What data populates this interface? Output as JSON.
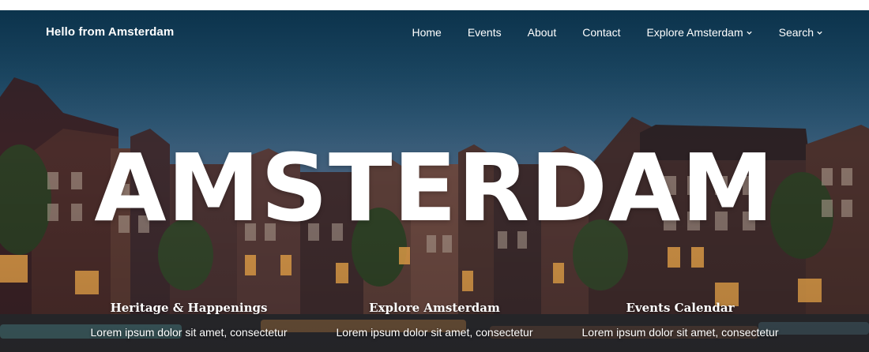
{
  "header": {
    "site_title": "Hello from Amsterdam",
    "nav": [
      {
        "label": "Home",
        "has_dropdown": false
      },
      {
        "label": "Events",
        "has_dropdown": false
      },
      {
        "label": "About",
        "has_dropdown": false
      },
      {
        "label": "Contact",
        "has_dropdown": false
      },
      {
        "label": "Explore Amsterdam",
        "has_dropdown": true
      },
      {
        "label": "Search",
        "has_dropdown": true
      }
    ]
  },
  "hero": {
    "title": "AMSTERDAM"
  },
  "features": [
    {
      "title": "Heritage & Happenings",
      "text": "Lorem ipsum dolor sit amet, consectetur"
    },
    {
      "title": "Explore Amsterdam",
      "text": "Lorem ipsum dolor sit amet, consectetur"
    },
    {
      "title": "Events Calendar",
      "text": "Lorem ipsum dolor sit amet, consectetur"
    }
  ],
  "colors": {
    "sky_top": "#0e3a55",
    "sky_bottom": "#4d6482",
    "text": "#ffffff"
  }
}
